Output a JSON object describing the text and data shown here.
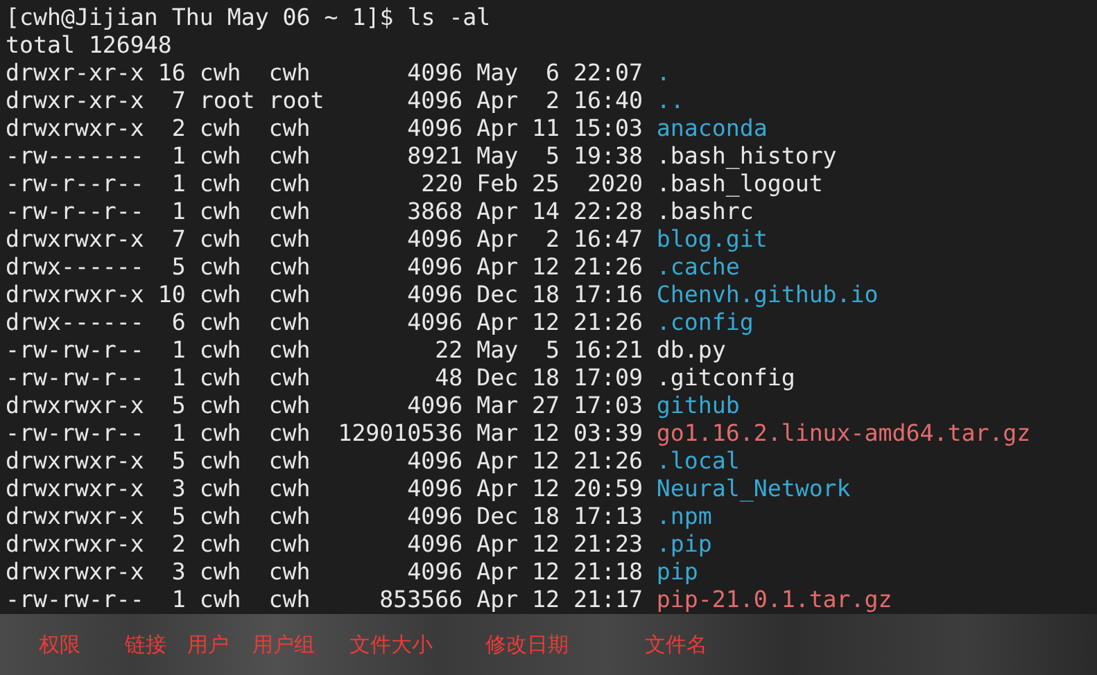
{
  "prompt": "[cwh@Jijian Thu May 06 ~ 1]$ ls -al",
  "total": "total 126948",
  "entries": [
    {
      "perms": "drwxr-xr-x",
      "links": "16",
      "owner": "cwh",
      "group": "cwh",
      "size": "4096",
      "month": "May",
      "day": "6",
      "time": "22:07",
      "name": ".",
      "kind": "dir"
    },
    {
      "perms": "drwxr-xr-x",
      "links": "7",
      "owner": "root",
      "group": "root",
      "size": "4096",
      "month": "Apr",
      "day": "2",
      "time": "16:40",
      "name": "..",
      "kind": "dir"
    },
    {
      "perms": "drwxrwxr-x",
      "links": "2",
      "owner": "cwh",
      "group": "cwh",
      "size": "4096",
      "month": "Apr",
      "day": "11",
      "time": "15:03",
      "name": "anaconda",
      "kind": "dir"
    },
    {
      "perms": "-rw-------",
      "links": "1",
      "owner": "cwh",
      "group": "cwh",
      "size": "8921",
      "month": "May",
      "day": "5",
      "time": "19:38",
      "name": ".bash_history",
      "kind": "file"
    },
    {
      "perms": "-rw-r--r--",
      "links": "1",
      "owner": "cwh",
      "group": "cwh",
      "size": "220",
      "month": "Feb",
      "day": "25",
      "time": "2020",
      "name": ".bash_logout",
      "kind": "file"
    },
    {
      "perms": "-rw-r--r--",
      "links": "1",
      "owner": "cwh",
      "group": "cwh",
      "size": "3868",
      "month": "Apr",
      "day": "14",
      "time": "22:28",
      "name": ".bashrc",
      "kind": "file"
    },
    {
      "perms": "drwxrwxr-x",
      "links": "7",
      "owner": "cwh",
      "group": "cwh",
      "size": "4096",
      "month": "Apr",
      "day": "2",
      "time": "16:47",
      "name": "blog.git",
      "kind": "dir"
    },
    {
      "perms": "drwx------",
      "links": "5",
      "owner": "cwh",
      "group": "cwh",
      "size": "4096",
      "month": "Apr",
      "day": "12",
      "time": "21:26",
      "name": ".cache",
      "kind": "dir"
    },
    {
      "perms": "drwxrwxr-x",
      "links": "10",
      "owner": "cwh",
      "group": "cwh",
      "size": "4096",
      "month": "Dec",
      "day": "18",
      "time": "17:16",
      "name": "Chenvh.github.io",
      "kind": "dir"
    },
    {
      "perms": "drwx------",
      "links": "6",
      "owner": "cwh",
      "group": "cwh",
      "size": "4096",
      "month": "Apr",
      "day": "12",
      "time": "21:26",
      "name": ".config",
      "kind": "dir"
    },
    {
      "perms": "-rw-rw-r--",
      "links": "1",
      "owner": "cwh",
      "group": "cwh",
      "size": "22",
      "month": "May",
      "day": "5",
      "time": "16:21",
      "name": "db.py",
      "kind": "file"
    },
    {
      "perms": "-rw-rw-r--",
      "links": "1",
      "owner": "cwh",
      "group": "cwh",
      "size": "48",
      "month": "Dec",
      "day": "18",
      "time": "17:09",
      "name": ".gitconfig",
      "kind": "file"
    },
    {
      "perms": "drwxrwxr-x",
      "links": "5",
      "owner": "cwh",
      "group": "cwh",
      "size": "4096",
      "month": "Mar",
      "day": "27",
      "time": "17:03",
      "name": "github",
      "kind": "dir"
    },
    {
      "perms": "-rw-rw-r--",
      "links": "1",
      "owner": "cwh",
      "group": "cwh",
      "size": "129010536",
      "month": "Mar",
      "day": "12",
      "time": "03:39",
      "name": "go1.16.2.linux-amd64.tar.gz",
      "kind": "archive"
    },
    {
      "perms": "drwxrwxr-x",
      "links": "5",
      "owner": "cwh",
      "group": "cwh",
      "size": "4096",
      "month": "Apr",
      "day": "12",
      "time": "21:26",
      "name": ".local",
      "kind": "dir"
    },
    {
      "perms": "drwxrwxr-x",
      "links": "3",
      "owner": "cwh",
      "group": "cwh",
      "size": "4096",
      "month": "Apr",
      "day": "12",
      "time": "20:59",
      "name": "Neural_Network",
      "kind": "dir"
    },
    {
      "perms": "drwxrwxr-x",
      "links": "5",
      "owner": "cwh",
      "group": "cwh",
      "size": "4096",
      "month": "Dec",
      "day": "18",
      "time": "17:13",
      "name": ".npm",
      "kind": "dir"
    },
    {
      "perms": "drwxrwxr-x",
      "links": "2",
      "owner": "cwh",
      "group": "cwh",
      "size": "4096",
      "month": "Apr",
      "day": "12",
      "time": "21:23",
      "name": ".pip",
      "kind": "dir"
    },
    {
      "perms": "drwxrwxr-x",
      "links": "3",
      "owner": "cwh",
      "group": "cwh",
      "size": "4096",
      "month": "Apr",
      "day": "12",
      "time": "21:18",
      "name": "pip",
      "kind": "dir"
    },
    {
      "perms": "-rw-rw-r--",
      "links": "1",
      "owner": "cwh",
      "group": "cwh",
      "size": "853566",
      "month": "Apr",
      "day": "12",
      "time": "21:17",
      "name": "pip-21.0.1.tar.gz",
      "kind": "archive"
    }
  ],
  "annotations": [
    "权限",
    "链接",
    "用户",
    "用户组",
    "文件大小",
    "修改日期",
    "文件名"
  ]
}
